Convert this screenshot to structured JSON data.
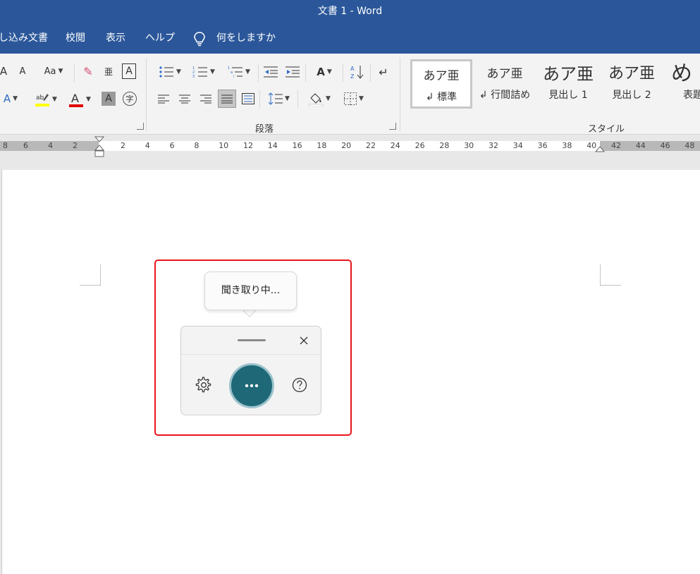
{
  "window": {
    "title": "文書 1  -  Word"
  },
  "menu": {
    "items": [
      "し込み文書",
      "校閲",
      "表示",
      "ヘルプ"
    ],
    "tell_me": "何をしますか"
  },
  "ribbon": {
    "font_group": {
      "change_case": "Aa"
    },
    "paragraph_group_label": "段落",
    "styles_group_label": "スタイル",
    "styles": [
      {
        "sample": "あア亜",
        "name": "↲ 標準"
      },
      {
        "sample": "あア亜",
        "name": "↲ 行間詰め"
      },
      {
        "sample": "あア亜",
        "name": "見出し 1"
      },
      {
        "sample": "あア亜",
        "name": "見出し 2"
      },
      {
        "sample": "め",
        "name": "表題"
      }
    ]
  },
  "ruler": {
    "left_labels": [
      "8",
      "6",
      "4",
      "2"
    ],
    "labels": [
      "2",
      "4",
      "6",
      "8",
      "10",
      "12",
      "14",
      "16",
      "18",
      "20",
      "22",
      "24",
      "26",
      "28",
      "30",
      "32",
      "34",
      "36",
      "38",
      "40",
      "42",
      "44",
      "46",
      "48"
    ]
  },
  "dictation": {
    "status_tooltip": "聞き取り中...",
    "mic_label": "•••"
  },
  "colors": {
    "title_blue": "#2b579a",
    "highlight_red": "#e8161c",
    "mic_teal": "#1f6878",
    "font_color_red": "#e00000",
    "highlight_yellow": "#ffff00"
  }
}
